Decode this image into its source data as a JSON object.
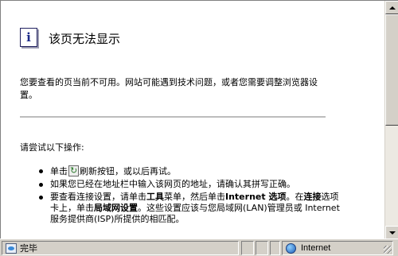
{
  "page": {
    "title": "该页无法显示",
    "description": "您要查看的页当前不可用。网站可能遇到技术问题，或者您需要调整浏览器设置。",
    "try_label": "请尝试以下操作:",
    "actions": {
      "refresh_before": "单击",
      "refresh_after": "刷新按钮，或以后再试。",
      "check_address": "如果您已经在地址栏中输入该网页的地址，请确认其拼写正确。",
      "conn_1": "要查看连接设置，请单击",
      "conn_tools": "工具",
      "conn_2": "菜单，然后单击",
      "conn_internet_options": "Internet 选项",
      "conn_3": "。在",
      "conn_connections": "连接",
      "conn_4": "选项卡上，单击",
      "conn_lan": "局域网设置",
      "conn_5": "。这些设置应该与您局域网(LAN)管理员或 Internet 服务提供商(ISP)所提供的相匹配。"
    },
    "info_icon_glyph": "i"
  },
  "statusbar": {
    "status": "完毕",
    "zone": "Internet"
  },
  "icons": {
    "info": "info-icon",
    "refresh": "refresh-icon",
    "page": "page-icon",
    "globe": "globe-icon"
  }
}
